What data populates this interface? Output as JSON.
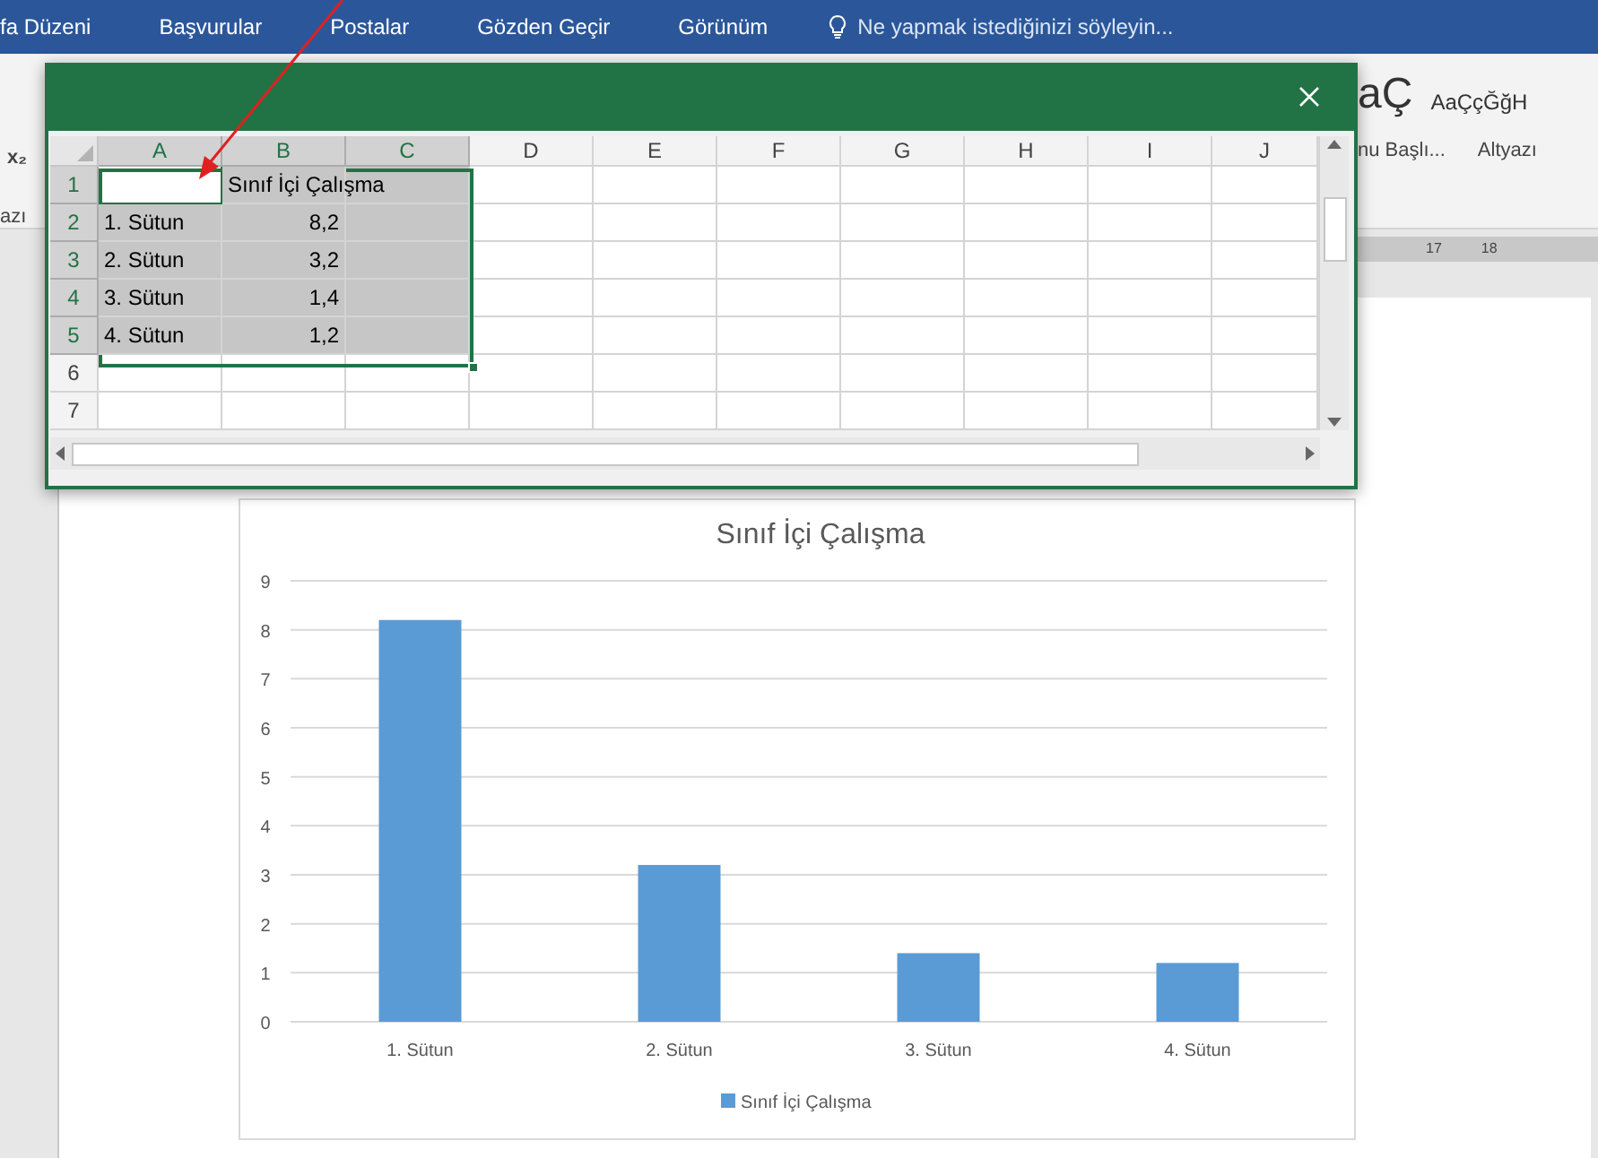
{
  "ribbon_tabs": [
    {
      "label": "fa Düzeni"
    },
    {
      "label": "Başvurular"
    },
    {
      "label": "Postalar"
    },
    {
      "label": "Gözden Geçir"
    },
    {
      "label": "Görünüm"
    }
  ],
  "tell_me": {
    "placeholder": "Ne yapmak istediğinizi söyleyin..."
  },
  "ribbon": {
    "left_items": [
      "x₂",
      "azı"
    ],
    "style_previews": [
      "aÇ",
      "AaÇçĞğH"
    ],
    "style_names": [
      "nu Başlı...",
      "Altyazı"
    ]
  },
  "ruler": {
    "labels": [
      "17",
      "18"
    ]
  },
  "spreadsheet": {
    "columns": [
      {
        "label": "A",
        "selected": true
      },
      {
        "label": "B",
        "selected": true
      },
      {
        "label": "C",
        "selected": true
      },
      {
        "label": "D",
        "selected": false
      },
      {
        "label": "E",
        "selected": false
      },
      {
        "label": "F",
        "selected": false
      },
      {
        "label": "G",
        "selected": false
      },
      {
        "label": "H",
        "selected": false
      },
      {
        "label": "I",
        "selected": false
      },
      {
        "label": "J",
        "selected": false
      }
    ],
    "rows": [
      {
        "header": "1",
        "selected": true,
        "cells": [
          {
            "kind": "blank",
            "active": true
          },
          {
            "kind": "text",
            "value": "Sınıf İçi Çalışma",
            "active": false
          }
        ]
      },
      {
        "header": "2",
        "selected": true,
        "cells": [
          {
            "kind": "text",
            "value": "1. Sütun",
            "active": false
          },
          {
            "kind": "number",
            "value": "8,2",
            "active": false
          }
        ]
      },
      {
        "header": "3",
        "selected": true,
        "cells": [
          {
            "kind": "text",
            "value": "2. Sütun",
            "active": false
          },
          {
            "kind": "number",
            "value": "3,2",
            "active": false
          }
        ]
      },
      {
        "header": "4",
        "selected": true,
        "cells": [
          {
            "kind": "text",
            "value": "3. Sütun",
            "active": false
          },
          {
            "kind": "number",
            "value": "1,4",
            "active": false
          }
        ]
      },
      {
        "header": "5",
        "selected": true,
        "cells": [
          {
            "kind": "text",
            "value": "4. Sütun",
            "active": false
          },
          {
            "kind": "number",
            "value": "1,2",
            "active": false
          }
        ]
      },
      {
        "header": "6",
        "selected": false
      },
      {
        "header": "7",
        "selected": false
      }
    ]
  },
  "chart": {
    "chart_data": {
      "type": "bar",
      "title": "Sınıf İçi Çalışma",
      "categories": [
        "1. Sütun",
        "2. Sütun",
        "3. Sütun",
        "4. Sütun"
      ],
      "series": [
        {
          "name": "Sınıf İçi Çalışma",
          "color": "#5b9bd5",
          "values": [
            8.2,
            3.2,
            1.4,
            1.2
          ]
        }
      ],
      "ylim": [
        0,
        9
      ],
      "grid": true,
      "yticks": [
        0,
        1,
        2,
        3,
        4,
        5,
        6,
        7,
        8,
        9
      ]
    }
  }
}
